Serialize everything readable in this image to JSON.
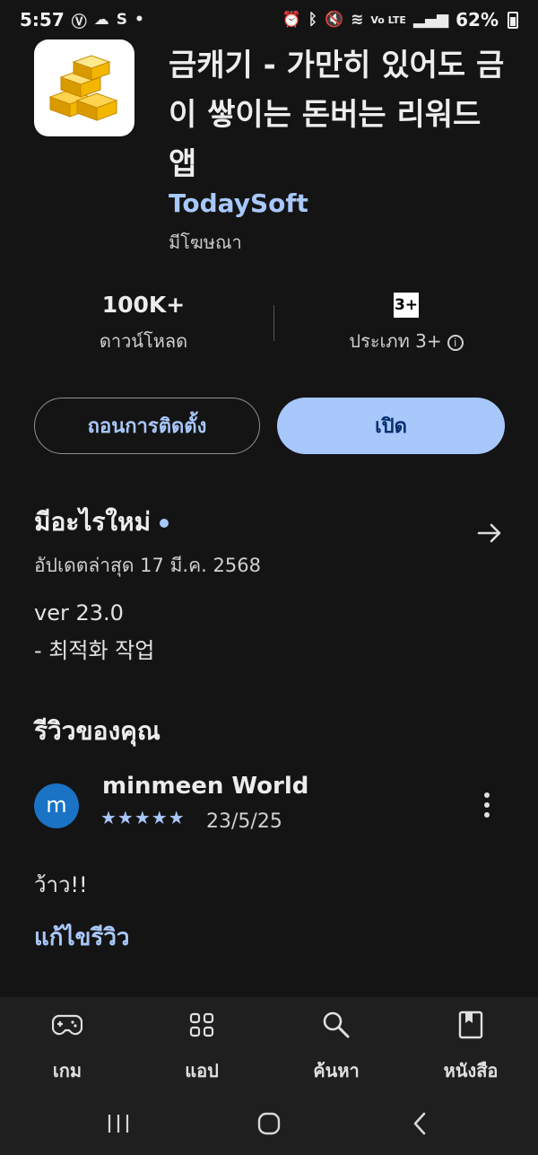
{
  "status_bar": {
    "time": "5:57",
    "notification_icons": [
      "v-icon",
      "cloud-icon",
      "s-icon",
      "dot-icon"
    ],
    "system_icons": [
      "alarm-icon",
      "bluetooth-icon",
      "mute-icon",
      "wifi-icon",
      "volte-icon",
      "signal-icon"
    ],
    "volte_text": "Vo LTE",
    "battery": "62%"
  },
  "app": {
    "title": "금캐기 - 가만히 있어도 금이 쌓이는 돈버는 리워드 앱",
    "developer": "TodaySoft",
    "ads_label": "มีโฆษณา",
    "icon": "gold-bars-icon"
  },
  "stats": {
    "downloads_value": "100K+",
    "downloads_label": "ดาวน์โหลด",
    "rating_badge": "3+",
    "rating_label": "ประเภท 3+"
  },
  "actions": {
    "uninstall_label": "ถอนการติดตั้ง",
    "open_label": "เปิด"
  },
  "whats_new": {
    "title": "มีอะไรใหม่",
    "updated": "อัปเดตล่าสุด 17 มี.ค. 2568",
    "version": "ver 23.0",
    "note": "- 최적화 작업"
  },
  "your_review": {
    "title": "รีวิวของคุณ",
    "avatar_letter": "m",
    "reviewer": "minmeen World",
    "stars": "★★★★★",
    "rating": 5,
    "date": "23/5/25",
    "text": "ว้าว!!",
    "edit_label": "แก้ไขรีวิว"
  },
  "bottom_nav": {
    "items": [
      {
        "label": "เกม",
        "icon": "gamepad-icon"
      },
      {
        "label": "แอป",
        "icon": "apps-grid-icon"
      },
      {
        "label": "ค้นหา",
        "icon": "search-icon"
      },
      {
        "label": "หนังสือ",
        "icon": "bookmark-book-icon"
      }
    ]
  },
  "colors": {
    "background": "#141414",
    "accent": "#a8c7fa",
    "open_button_text": "#062e6f",
    "avatar": "#1a73c4"
  }
}
